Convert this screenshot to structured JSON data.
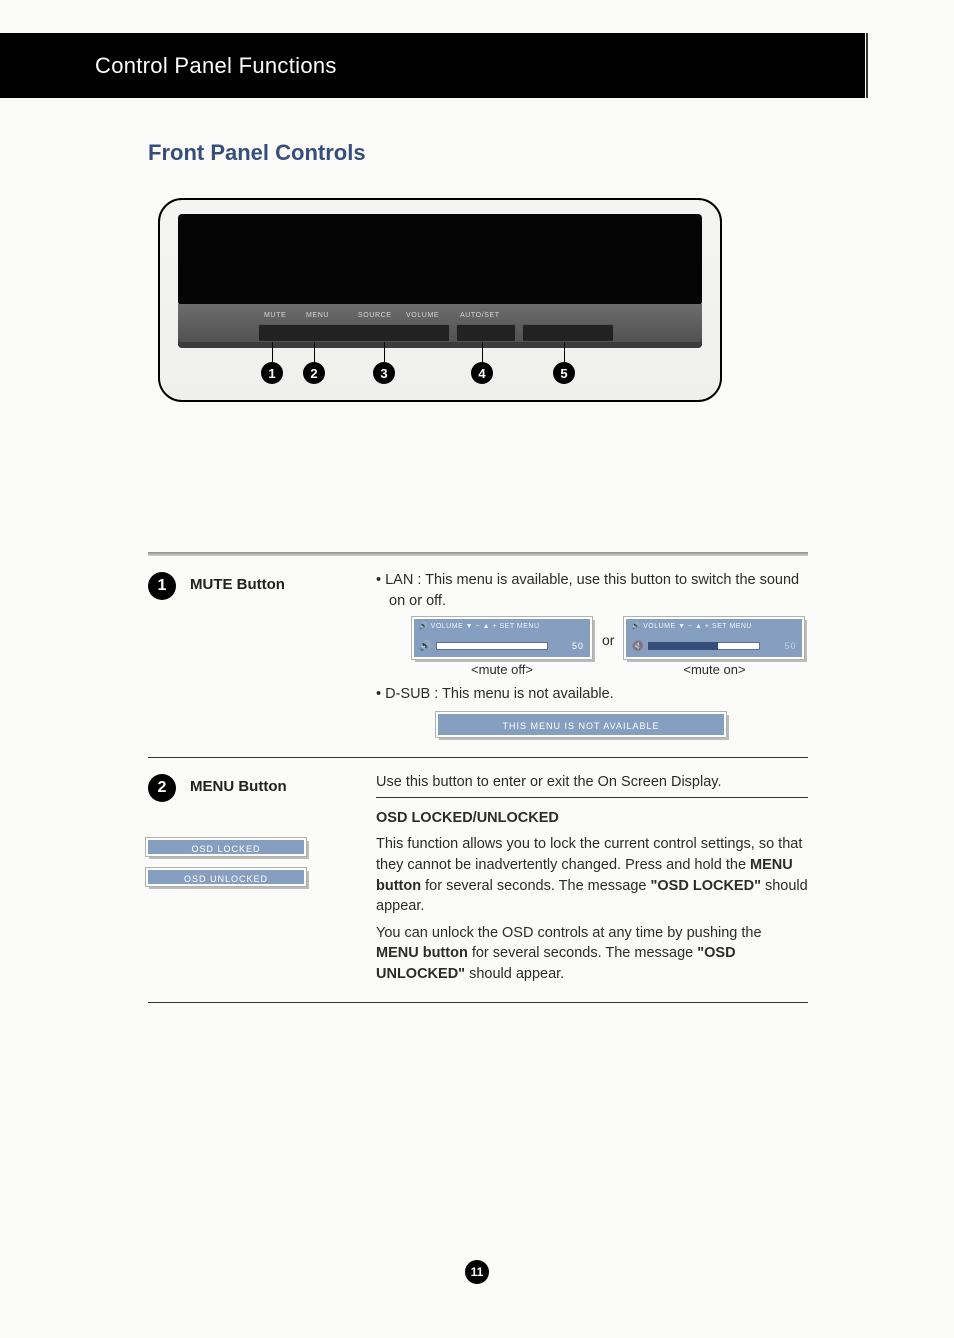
{
  "header": {
    "title": "Control Panel Functions"
  },
  "subtitle": "Front Panel Controls",
  "diagram": {
    "labels": [
      "MUTE",
      "MENU",
      "SOURCE",
      "VOLUME",
      "AUTO/SET"
    ],
    "numbers": [
      "1",
      "2",
      "3",
      "4",
      "5"
    ]
  },
  "item1": {
    "num": "1",
    "title": "MUTE Button",
    "lan": "• LAN : This menu is available, use this button to switch the sound on or off.",
    "or": "or",
    "mute_off": "<mute off>",
    "mute_on": "<mute on>",
    "dsub": "• D-SUB : This menu is not available.",
    "not_avail": "THIS MENU IS NOT AVAILABLE",
    "vol_header": "VOLUME   ▼ − ▲ +  SET  MENU",
    "vol_value": "50"
  },
  "item2": {
    "num": "2",
    "title": "MENU Button",
    "intro": "Use this button to enter or exit the On Screen Display.",
    "locked_title": "OSD LOCKED/UNLOCKED",
    "p1a": "This function allows you to lock the current control settings, so that they cannot be inadvertently changed. Press and hold the ",
    "p1b": "MENU button",
    "p1c": " for several seconds. The message ",
    "p1d": "\"OSD LOCKED\"",
    "p1e": " should appear.",
    "p2a": "You can unlock the OSD controls at any time by pushing the ",
    "p2b": "MENU button",
    "p2c": " for several seconds. The message ",
    "p2d": "\"OSD UNLOCKED\"",
    "p2e": " should appear.",
    "osd_locked": "OSD LOCKED",
    "osd_unlocked": "OSD UNLOCKED"
  },
  "page_number": "11"
}
